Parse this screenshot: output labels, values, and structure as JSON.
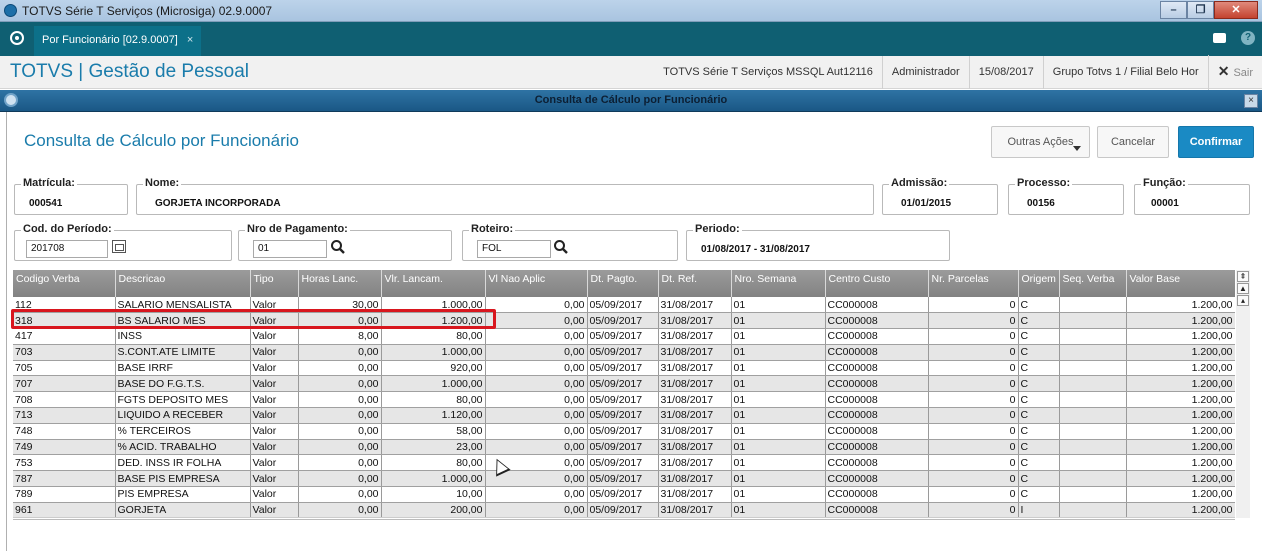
{
  "window": {
    "title": "TOTVS Série T Serviços (Microsiga) 02.9.0007",
    "controls": [
      "–",
      "❐",
      "✕"
    ]
  },
  "tabbar": {
    "tab_label": "Por Funcionário [02.9.0007]",
    "tab_close": "×",
    "help": "?"
  },
  "appbar": {
    "brand": "TOTVS | Gestão de Pessoal",
    "env": "TOTVS Série T Serviços MSSQL Aut12116",
    "user": "Administrador",
    "date": "15/08/2017",
    "branch": "Grupo Totvs 1 / Filial Belo Hor",
    "exit_label": "Sair"
  },
  "dialog": {
    "title": "Consulta de Cálculo por Funcionário",
    "close": "×"
  },
  "page": {
    "title": "Consulta de Cálculo por Funcionário",
    "buttons": {
      "outras": "Outras Ações",
      "cancelar": "Cancelar",
      "confirmar": "Confirmar"
    }
  },
  "fields": {
    "matricula": {
      "label": "Matrícula:",
      "value": "000541"
    },
    "nome": {
      "label": "Nome:",
      "value": "GORJETA INCORPORADA"
    },
    "admissao": {
      "label": "Admissão:",
      "value": "01/01/2015"
    },
    "processo": {
      "label": "Processo:",
      "value": "00156"
    },
    "funcao": {
      "label": "Função:",
      "value": "00001"
    },
    "periodo_cod": {
      "label": "Cod. do Período:",
      "value": "201708"
    },
    "nro_pagamento": {
      "label": "Nro de Pagamento:",
      "value": "01"
    },
    "roteiro": {
      "label": "Roteiro:",
      "value": "FOL"
    },
    "periodo": {
      "label": "Periodo:",
      "value": "01/08/2017 - 31/08/2017"
    }
  },
  "grid": {
    "columns": [
      "Codigo Verba",
      "Descricao",
      "Tipo",
      "Horas Lanc.",
      "Vlr. Lancam.",
      "Vl Nao Aplic",
      "Dt. Pagto.",
      "Dt. Ref.",
      "Nro. Semana",
      "Centro Custo",
      "Nr. Parcelas",
      "Origem",
      "Seq. Verba",
      "Valor Base"
    ],
    "rows": [
      [
        "112",
        "SALARIO MENSALISTA",
        "Valor",
        "30,00",
        "1.000,00",
        "0,00",
        "05/09/2017",
        "31/08/2017",
        "01",
        "CC000008",
        "0",
        "C",
        "",
        "1.200,00"
      ],
      [
        "318",
        "BS SALARIO MES",
        "Valor",
        "0,00",
        "1.200,00",
        "0,00",
        "05/09/2017",
        "31/08/2017",
        "01",
        "CC000008",
        "0",
        "C",
        "",
        "1.200,00"
      ],
      [
        "417",
        "INSS",
        "Valor",
        "8,00",
        "80,00",
        "0,00",
        "05/09/2017",
        "31/08/2017",
        "01",
        "CC000008",
        "0",
        "C",
        "",
        "1.200,00"
      ],
      [
        "703",
        "S.CONT.ATE LIMITE",
        "Valor",
        "0,00",
        "1.000,00",
        "0,00",
        "05/09/2017",
        "31/08/2017",
        "01",
        "CC000008",
        "0",
        "C",
        "",
        "1.200,00"
      ],
      [
        "705",
        "BASE IRRF",
        "Valor",
        "0,00",
        "920,00",
        "0,00",
        "05/09/2017",
        "31/08/2017",
        "01",
        "CC000008",
        "0",
        "C",
        "",
        "1.200,00"
      ],
      [
        "707",
        "BASE DO F.G.T.S.",
        "Valor",
        "0,00",
        "1.000,00",
        "0,00",
        "05/09/2017",
        "31/08/2017",
        "01",
        "CC000008",
        "0",
        "C",
        "",
        "1.200,00"
      ],
      [
        "708",
        "FGTS DEPOSITO MES",
        "Valor",
        "0,00",
        "80,00",
        "0,00",
        "05/09/2017",
        "31/08/2017",
        "01",
        "CC000008",
        "0",
        "C",
        "",
        "1.200,00"
      ],
      [
        "713",
        "LIQUIDO A RECEBER",
        "Valor",
        "0,00",
        "1.120,00",
        "0,00",
        "05/09/2017",
        "31/08/2017",
        "01",
        "CC000008",
        "0",
        "C",
        "",
        "1.200,00"
      ],
      [
        "748",
        "% TERCEIROS",
        "Valor",
        "0,00",
        "58,00",
        "0,00",
        "05/09/2017",
        "31/08/2017",
        "01",
        "CC000008",
        "0",
        "C",
        "",
        "1.200,00"
      ],
      [
        "749",
        "% ACID. TRABALHO",
        "Valor",
        "0,00",
        "23,00",
        "0,00",
        "05/09/2017",
        "31/08/2017",
        "01",
        "CC000008",
        "0",
        "C",
        "",
        "1.200,00"
      ],
      [
        "753",
        "DED. INSS IR FOLHA",
        "Valor",
        "0,00",
        "80,00",
        "0,00",
        "05/09/2017",
        "31/08/2017",
        "01",
        "CC000008",
        "0",
        "C",
        "",
        "1.200,00"
      ],
      [
        "787",
        "BASE PIS EMPRESA",
        "Valor",
        "0,00",
        "1.000,00",
        "0,00",
        "05/09/2017",
        "31/08/2017",
        "01",
        "CC000008",
        "0",
        "C",
        "",
        "1.200,00"
      ],
      [
        "789",
        "PIS EMPRESA",
        "Valor",
        "0,00",
        "10,00",
        "0,00",
        "05/09/2017",
        "31/08/2017",
        "01",
        "CC000008",
        "0",
        "C",
        "",
        "1.200,00"
      ],
      [
        "961",
        "GORJETA",
        "Valor",
        "0,00",
        "200,00",
        "0,00",
        "05/09/2017",
        "31/08/2017",
        "01",
        "CC000008",
        "0",
        "I",
        "",
        "1.200,00"
      ]
    ],
    "numeric_columns": [
      3,
      4,
      5,
      10,
      13
    ]
  },
  "colors": {
    "accent": "#1a7cab",
    "tabbar": "#0f5f72",
    "confirm": "#1a8ac4",
    "highlight": "#d8161e"
  }
}
